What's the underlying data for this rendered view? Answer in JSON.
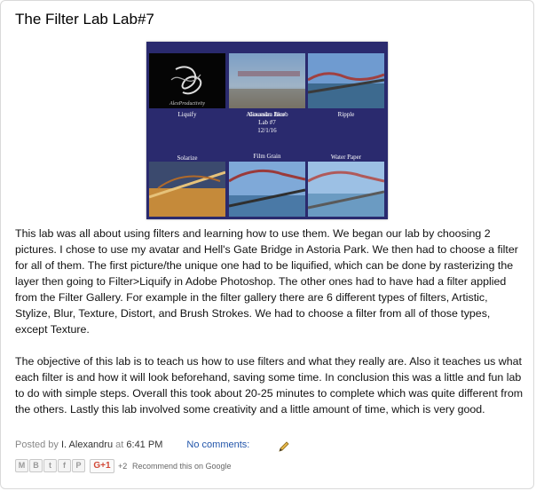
{
  "post": {
    "title": "The Filter Lab Lab#7",
    "image": {
      "captions": {
        "liquify": "Liquify",
        "gaussian_blur": "Gaussian Blur",
        "ripple": "Ripple",
        "solarize": "Solarize",
        "film_grain": "Film Grain",
        "water_paper": "Water Paper"
      },
      "center_text": [
        "Alexandru Jacob",
        "Lab #7",
        "12/1/16"
      ]
    },
    "paragraphs": [
      "This lab was all about using filters and learning how to use them. We began our lab by choosing 2 pictures. I chose to use my avatar and Hell's Gate Bridge in Astoria Park. We then had to choose a filter for all of them. The first picture/the unique one had to be liquified, which can be done by rasterizing the layer then going to Filter>Liquify in Adobe Photoshop. The other ones had to have had a filter applied from the Filter Gallery. For example  in the filter gallery there are 6 different types of filters, Artistic, Stylize, Blur, Texture, Distort, and Brush Strokes. We had to choose a filter from all of those types, except Texture.",
      "The objective of this lab is to teach us how to use filters and what they really are. Also it teaches us what each filter is and how it will look beforehand, saving some time. In conclusion this was a little and fun lab to do with simple steps. Overall this took about 20-25 minutes to complete which was quite different from the others. Lastly this lab involved some creativity and a little amount of time, which is very good."
    ],
    "footer": {
      "posted_by": "Posted by",
      "author": "I. Alexandru",
      "at": "at",
      "time": "6:41 PM",
      "comments": "No comments:"
    },
    "share": {
      "email": "M",
      "blog": "B",
      "twitter": "t",
      "facebook": "f",
      "pinterest": "P",
      "gplus": "G+1",
      "gplus_count": "+2",
      "recommend": "Recommend this on Google"
    }
  },
  "colors": {
    "link": "#2255aa",
    "image_bg": "#2a2a6e",
    "gplus": "#d14836"
  }
}
